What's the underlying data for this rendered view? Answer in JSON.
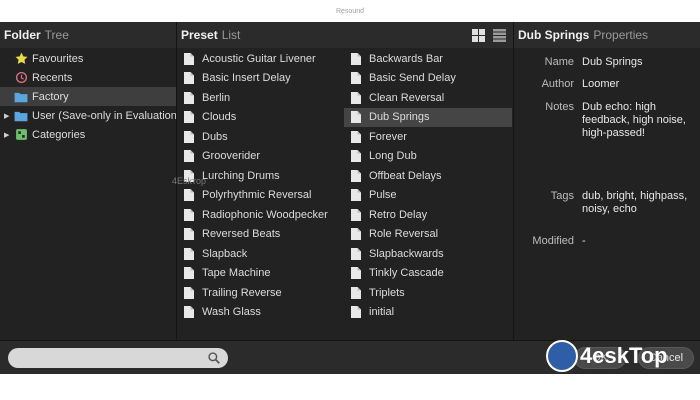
{
  "window": {
    "title": "Resound"
  },
  "folder_panel": {
    "header_bold": "Folder",
    "header_sub": "Tree",
    "items": [
      {
        "label": "Favourites",
        "icon": "star-icon",
        "expandable": false,
        "selected": false
      },
      {
        "label": "Recents",
        "icon": "history-icon",
        "expandable": false,
        "selected": false
      },
      {
        "label": "Factory",
        "icon": "folder-icon",
        "expandable": false,
        "selected": true
      },
      {
        "label": "User (Save-only in Evaluation)",
        "icon": "folder-icon",
        "expandable": true,
        "selected": false
      },
      {
        "label": "Categories",
        "icon": "tag-icon",
        "expandable": true,
        "selected": false
      }
    ]
  },
  "preset_panel": {
    "header_bold": "Preset",
    "header_sub": "List",
    "view_buttons": [
      "grid-view-icon",
      "list-view-icon"
    ],
    "column1": [
      "Acoustic Guitar Livener",
      "Basic Insert Delay",
      "Berlin",
      "Clouds",
      "Dubs",
      "Grooverider",
      "Lurching Drums",
      "Polyrhythmic Reversal",
      "Radiophonic Woodpecker",
      "Reversed Beats",
      "Slapback",
      "Tape Machine",
      "Trailing Reverse",
      "Wash Glass"
    ],
    "column2": [
      "Backwards Bar",
      "Basic Send Delay",
      "Clean Reversal",
      "Dub Springs",
      "Forever",
      "Long Dub",
      "Offbeat Delays",
      "Pulse",
      "Retro Delay",
      "Role Reversal",
      "Slapbackwards",
      "Tinkly Cascade",
      "Triplets",
      "initial"
    ],
    "selected": "Dub Springs"
  },
  "properties_panel": {
    "header_bold": "Dub Springs",
    "header_sub": "Properties",
    "name_label": "Name",
    "name_value": "Dub Springs",
    "author_label": "Author",
    "author_value": "Loomer",
    "notes_label": "Notes",
    "notes_value": "Dub echo: high feedback, high noise, high-passed!",
    "tags_label": "Tags",
    "tags_value": "dub, bright, highpass, noisy, echo",
    "modified_label": "Modified",
    "modified_value": "-"
  },
  "bottom": {
    "search_value": "",
    "search_placeholder": "",
    "ok_label": "OK",
    "cancel_label": "Cancel"
  },
  "watermark": {
    "brand": "4eskTop",
    "mid_text": "4Eskтор"
  },
  "colors": {
    "panel_bg": "#222222",
    "window_bg": "#2b2b2b",
    "selection": "#454545",
    "folder_blue": "#5aa7e0",
    "star_yellow": "#e8d84a",
    "recents_pink": "#e0708a",
    "tag_green": "#6dbf6a"
  }
}
